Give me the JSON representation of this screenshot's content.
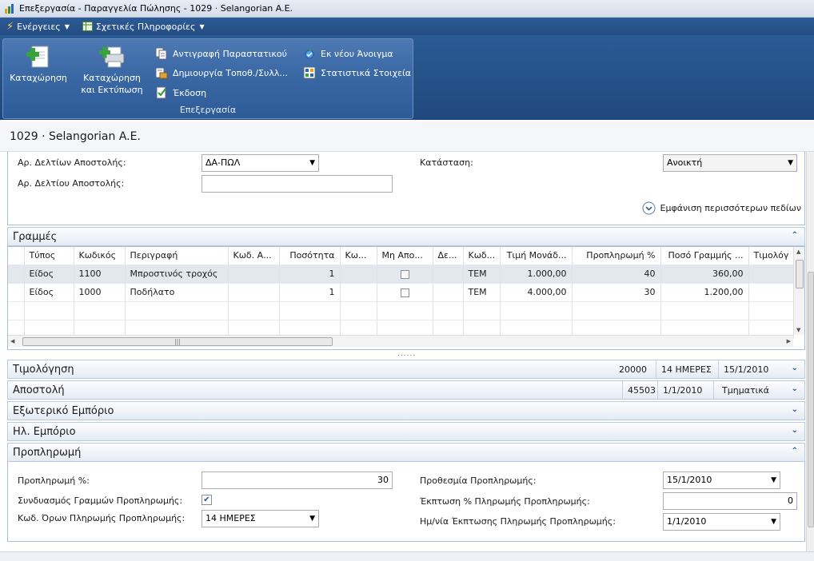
{
  "window": {
    "title": "Επεξεργασία - Παραγγελία Πώλησης - 1029 · Selangorian A.E."
  },
  "menubar": {
    "actions": "Ενέργειες",
    "related": "Σχετικές Πληροφορίες"
  },
  "ribbon": {
    "post": "Καταχώρηση",
    "post_print_line1": "Καταχώρηση",
    "post_print_line2": "και Εκτύπωση",
    "copy_document": "Αντιγραφή Παραστατικού",
    "create_whse": "Δημιουργία Τοποθ./Συλλ...",
    "release": "Έκδοση",
    "reopen": "Εκ νέου Άνοιγμα",
    "statistics": "Στατιστικά Στοιχεία",
    "group_caption": "Επεξεργασία"
  },
  "page": {
    "title": "1029 · Selangorian A.E."
  },
  "general": {
    "shipment_nos_label": "Αρ. Δελτίων Αποστολής:",
    "shipment_nos_value": "ΔΑ-ΠΩΛ",
    "shipment_no_label": "Αρ. Δελτίου Αποστολής:",
    "shipment_no_value": "",
    "status_label": "Κατάσταση:",
    "status_value": "Ανοικτή",
    "show_more": "Εμφάνιση περισσότερων πεδίων"
  },
  "lines": {
    "title": "Γραμμές",
    "columns": [
      "Τύπος",
      "Κωδικός",
      "Περιγραφή",
      "Κωδ. Α...",
      "Ποσότητα",
      "Κω...",
      "Μη Απο...",
      "Δε...",
      "Κωδ...",
      "Τιμή Μονάδ...",
      "Προπληρωμή %",
      "Ποσό Γραμμής ...",
      "Τιμολόγ"
    ],
    "rows": [
      {
        "type": "Είδος",
        "no": "1100",
        "desc": "Μπροστινός τροχός",
        "qty": "1",
        "uom": "ΤΕΜ",
        "price": "1.000,00",
        "prepay": "40",
        "amount": "360,00"
      },
      {
        "type": "Είδος",
        "no": "1000",
        "desc": "Ποδήλατο",
        "qty": "1",
        "uom": "ΤΕΜ",
        "price": "4.000,00",
        "prepay": "30",
        "amount": "1.200,00"
      }
    ]
  },
  "sections": {
    "invoicing": {
      "title": "Τιμολόγηση",
      "v1": "20000",
      "v2": "14 ΗΜΕΡΕΣ",
      "v3": "15/1/2010"
    },
    "shipping": {
      "title": "Αποστολή",
      "v1": "45503",
      "v2": "1/1/2010",
      "v3": "Τμηματικά"
    },
    "foreign": {
      "title": "Εξωτερικό Εμπόριο"
    },
    "ecommerce": {
      "title": "Ηλ. Εμπόριο"
    },
    "prepayment": {
      "title": "Προπληρωμή"
    }
  },
  "prepayment": {
    "pct_label": "Προπληρωμή %:",
    "pct_value": "30",
    "compress_label": "Συνδυασμός Γραμμών Προπληρωμής:",
    "compress_checked": true,
    "terms_label": "Κωδ. Όρων Πληρωμής Προπληρωμής:",
    "terms_value": "14 ΗΜΕΡΕΣ",
    "due_label": "Προθεσμία Προπληρωμής:",
    "due_value": "15/1/2010",
    "disc_label": "Έκπτωση % Πληρωμής Προπληρωμής:",
    "disc_value": "0",
    "disc_date_label": "Ημ/νία Έκπτωσης Πληρωμής Προπληρωμής:",
    "disc_date_value": "1/1/2010"
  }
}
